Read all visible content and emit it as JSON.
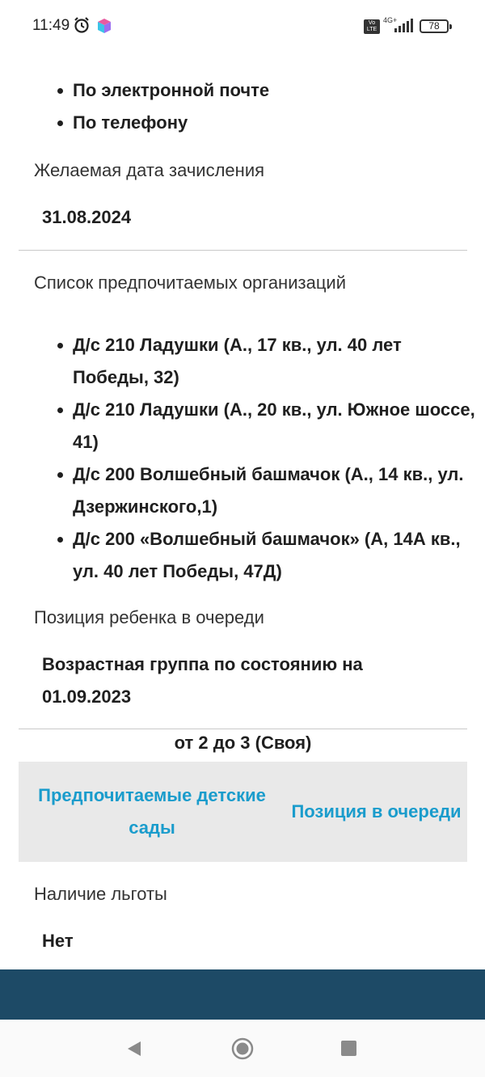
{
  "status_bar": {
    "time": "11:49",
    "network": "4G+",
    "battery": "78"
  },
  "contact_methods": [
    "По электронной почте",
    "По телефону"
  ],
  "enrollment": {
    "label": "Желаемая дата зачисления",
    "value": "31.08.2024"
  },
  "organizations": {
    "label": "Список предпочитаемых организаций",
    "items": [
      "Д/с 210 Ладушки (А., 17 кв., ул. 40 лет Победы, 32)",
      "Д/с 210 Ладушки (А., 20 кв., ул. Южное шоссе, 41)",
      "Д/с 200 Волшебный башмачок (А., 14 кв., ул. Дзержинского,1)",
      "Д/с 200 «Волшебный башмачок» (А, 14А кв., ул. 40 лет Победы, 47Д)"
    ]
  },
  "queue": {
    "label": "Позиция ребенка в очереди",
    "age_group_label": "Возрастная группа по состоянию на 01.09.2023",
    "age_group_value": "от 2 до 3 (Своя)",
    "table_headers": [
      "Предпочитаемые детские сады",
      "Позиция в очереди"
    ]
  },
  "benefit": {
    "label": "Наличие льготы",
    "value": "Нет"
  },
  "colors": {
    "accent": "#1a9ccc",
    "band": "#1d4a66",
    "table_header_bg": "#e9e9e9"
  },
  "icons": {
    "alarm": "alarm-clock-icon",
    "app": "app-cube-icon",
    "volte": "volte-icon",
    "signal": "signal-icon",
    "battery": "battery-icon",
    "back": "back-triangle-icon",
    "home": "home-circle-icon",
    "recent": "recent-square-icon"
  }
}
